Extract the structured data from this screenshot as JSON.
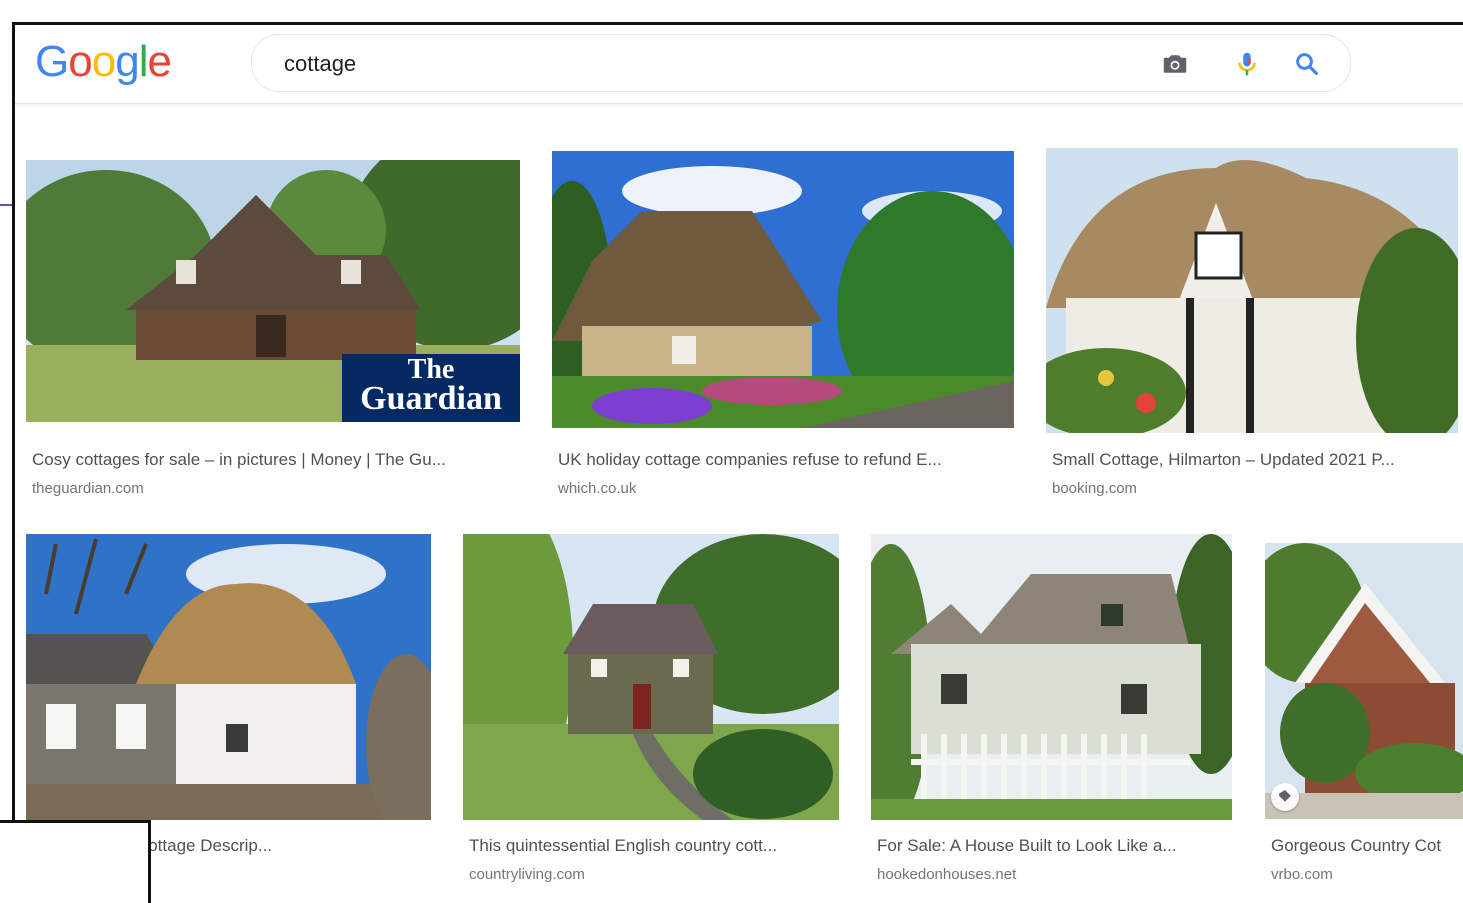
{
  "search": {
    "logo_letters": [
      "G",
      "o",
      "o",
      "g",
      "l",
      "e"
    ],
    "query": "cottage"
  },
  "icons": {
    "camera": "camera-icon",
    "mic": "microphone-icon",
    "search": "magnifier-icon"
  },
  "colors": {
    "google_blue": "#4285f4",
    "google_red": "#ea4335",
    "google_yellow": "#fbbc05",
    "google_green": "#34a853",
    "guardian_navy": "#052962"
  },
  "results_row1": [
    {
      "title": "Cosy cottages for sale – in pictures | Money | The Gu...",
      "source": "theguardian.com",
      "badge_line1": "The",
      "badge_line2": "Guardian"
    },
    {
      "title": "UK holiday cottage companies refuse to refund E...",
      "source": "which.co.uk"
    },
    {
      "title": "Small Cottage, Hilmarton – Updated 2021 P...",
      "source": "booking.com"
    }
  ],
  "results_row2": [
    {
      "title": "tage, Holiday Cottage Descrip...",
      "source": ""
    },
    {
      "title": "This quintessential English country cott...",
      "source": "countryliving.com"
    },
    {
      "title": "For Sale: A House Built to Look Like a...",
      "source": "hookedonhouses.net"
    },
    {
      "title": "Gorgeous Country Cot",
      "source": "vrbo.com"
    }
  ]
}
